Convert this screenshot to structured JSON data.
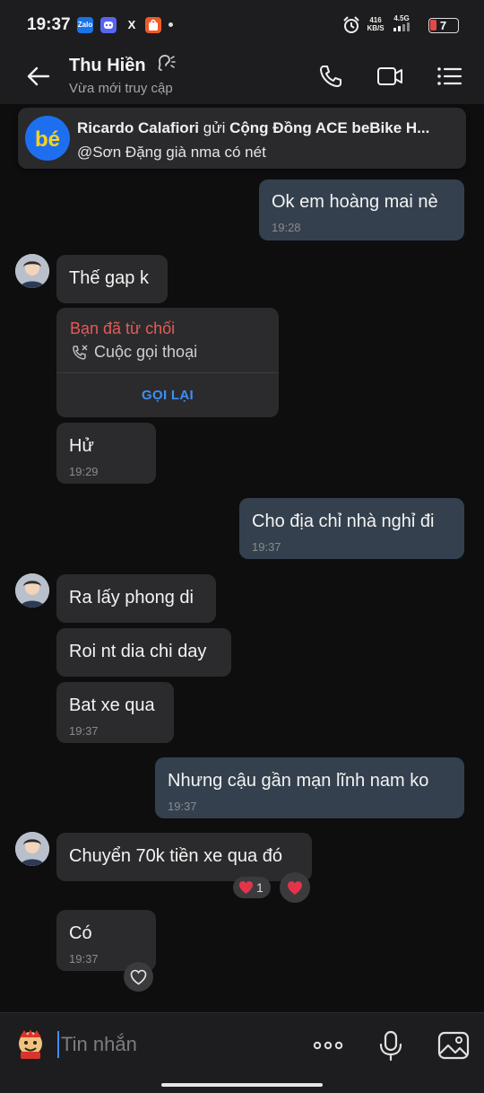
{
  "status_bar": {
    "time": "19:37",
    "apps": [
      "Zalo",
      "Discord",
      "X",
      "Shopee"
    ],
    "net_speed": "416",
    "net_unit": "KB/S",
    "network": "4.5G",
    "battery": "7"
  },
  "header": {
    "name": "Thu Hiền",
    "status": "Vừa mới truy cập"
  },
  "notification": {
    "sender": "Ricardo Calafiori",
    "verb": "gửi",
    "group": "Cộng Đồng ACE beBike H...",
    "body": "@Sơn Đặng già nma có nét",
    "logo_text": "bé"
  },
  "messages": {
    "m1": {
      "text": "Ok em hoàng mai nè",
      "time": "19:28"
    },
    "m2": {
      "text": "Thế gap k"
    },
    "call": {
      "title": "Bạn đã từ chối",
      "subtitle": "Cuộc gọi thoại",
      "action": "GỌI LẠI"
    },
    "m3": {
      "text": "Hử",
      "time": "19:29"
    },
    "m4": {
      "text": "Cho địa chỉ nhà nghỉ đi",
      "time": "19:37"
    },
    "m5": {
      "text": "Ra lấy phong di"
    },
    "m6": {
      "text": "Roi nt dia chi day"
    },
    "m7": {
      "text": "Bat xe qua",
      "time": "19:37"
    },
    "m8": {
      "text": "Nhưng cậu gần mạn lĩnh nam ko",
      "time": "19:37"
    },
    "m9": {
      "text": "Chuyển 70k tiền xe qua đó",
      "reaction_count": "1"
    },
    "m10": {
      "text": "Có",
      "time": "19:37"
    }
  },
  "input": {
    "placeholder": "Tin nhắn"
  },
  "colors": {
    "background": "#0e0e0f",
    "bar": "#1d1d1f",
    "incoming_bubble": "#2b2b2d",
    "outgoing_bubble": "#34404e",
    "accent": "#3e8ff5",
    "declined": "#e85a56",
    "heart": "#e5344a"
  }
}
